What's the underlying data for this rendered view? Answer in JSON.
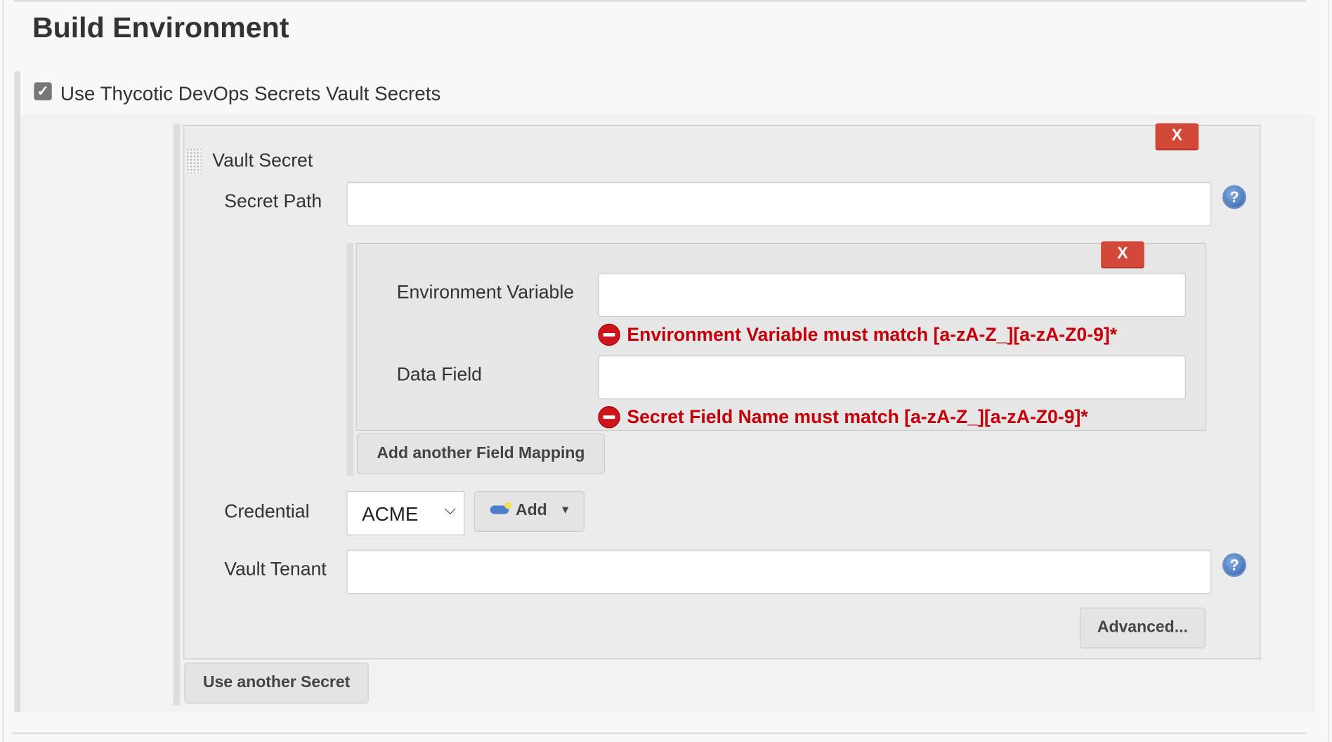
{
  "section": {
    "title": "Build Environment"
  },
  "option": {
    "label": "Use Thycotic DevOps Secrets Vault Secrets",
    "checked": true
  },
  "vault_secret": {
    "title": "Vault Secret",
    "delete_label": "X",
    "secret_path": {
      "label": "Secret Path",
      "value": ""
    },
    "field_mapping": {
      "delete_label": "X",
      "env_var": {
        "label": "Environment Variable",
        "value": "",
        "error": "Environment Variable must match [a-zA-Z_][a-zA-Z0-9]*"
      },
      "data_field": {
        "label": "Data Field",
        "value": "",
        "error": "Secret Field Name must match [a-zA-Z_][a-zA-Z0-9]*"
      }
    },
    "add_mapping_label": "Add another Field Mapping",
    "credential": {
      "label": "Credential",
      "selected": "ACME",
      "add_label": "Add"
    },
    "vault_tenant": {
      "label": "Vault Tenant",
      "value": ""
    },
    "advanced_label": "Advanced...",
    "help_glyph": "?"
  },
  "use_another_label": "Use another Secret",
  "colors": {
    "error": "#c4000a",
    "delete": "#d24939"
  }
}
